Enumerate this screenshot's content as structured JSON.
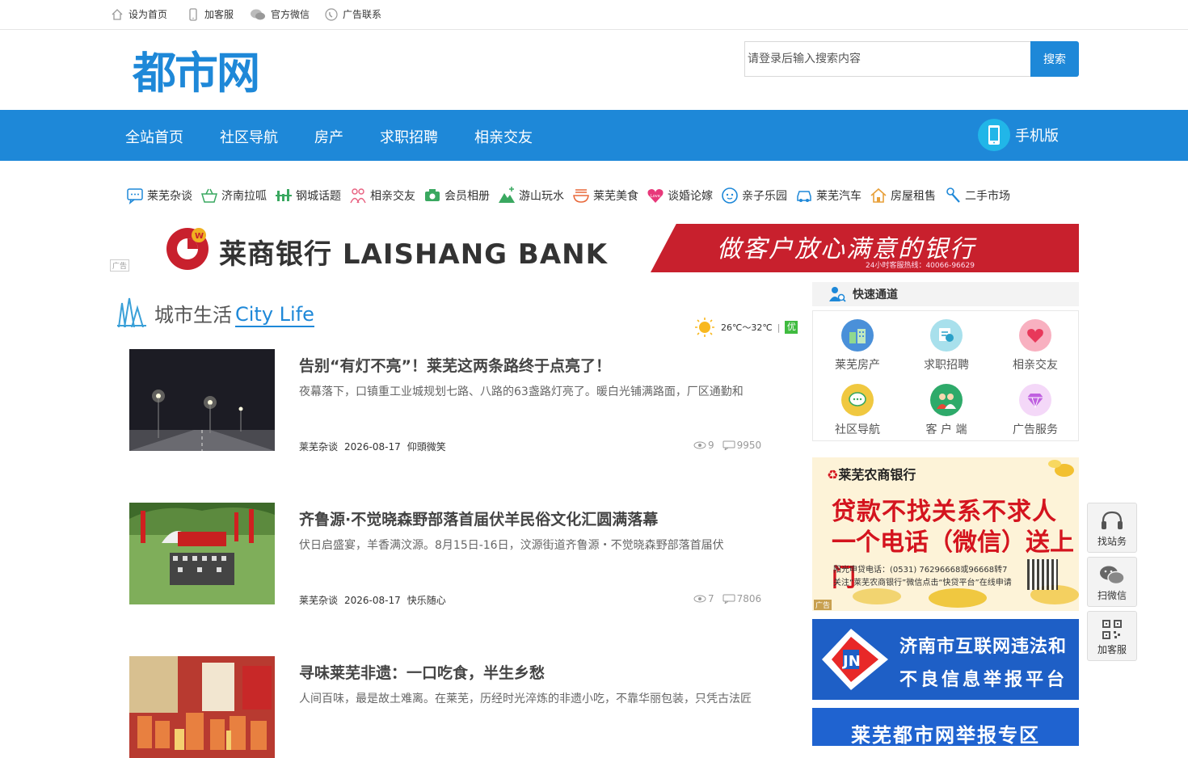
{
  "topbar": {
    "items": [
      {
        "label": "设为首页",
        "icon": "home-icon"
      },
      {
        "label": "加客服",
        "icon": "phone-icon"
      },
      {
        "label": "官方微信",
        "icon": "wechat-icon"
      },
      {
        "label": "广告联系",
        "icon": "contact-icon"
      }
    ]
  },
  "header": {
    "logo_text": "都市网",
    "search": {
      "placeholder": "请登录后输入搜索内容",
      "button": "搜索"
    }
  },
  "nav": {
    "items": [
      "全站首页",
      "社区导航",
      "房产",
      "求职招聘",
      "相亲交友"
    ],
    "mobile": "手机版"
  },
  "categories": [
    {
      "label": "莱芜杂谈",
      "icon": "chat-icon"
    },
    {
      "label": "济南拉呱",
      "icon": "basket-icon"
    },
    {
      "label": "钢城话题",
      "icon": "bars-icon"
    },
    {
      "label": "相亲交友",
      "icon": "couple-icon"
    },
    {
      "label": "会员相册",
      "icon": "camera-icon"
    },
    {
      "label": "游山玩水",
      "icon": "mountain-icon"
    },
    {
      "label": "莱芜美食",
      "icon": "bowl-icon"
    },
    {
      "label": "谈婚论嫁",
      "icon": "heart-love-icon"
    },
    {
      "label": "亲子乐园",
      "icon": "baby-icon"
    },
    {
      "label": "莱芜汽车",
      "icon": "car-icon"
    },
    {
      "label": "房屋租售",
      "icon": "house-icon"
    },
    {
      "label": "二手市场",
      "icon": "wrench-icon"
    }
  ],
  "banner": {
    "ad_tag": "广告",
    "bank_name": "莱商银行 LAISHANG BANK",
    "slogan": "做客户放心满意的银行",
    "hotline": "24小时客服热线：40066-96629"
  },
  "section": {
    "title_zh": "城市生活",
    "title_en": "City Life"
  },
  "weather": {
    "temp": "26℃～32℃",
    "sep": "|",
    "aq": "优"
  },
  "articles": [
    {
      "title": "告别“有灯不亮”！莱芜这两条路终于点亮了！",
      "desc": "夜幕落下，口镇重工业城规划七路、八路的63盏路灯亮了。暖白光铺满路面，厂区通勤和",
      "category": "莱芜杂谈",
      "date": "2026-08-17",
      "author": "仰頭微笑",
      "views": "9",
      "comments": "9950"
    },
    {
      "title": "齐鲁源·不觉晓森野部落首届伏羊民俗文化汇圆满落幕",
      "desc": "伏日启盛宴，羊香满汶源。8月15日-16日，汶源街道齐鲁源・不觉晓森野部落首届伏",
      "category": "莱芜杂谈",
      "date": "2026-08-17",
      "author": "快乐随心",
      "views": "7",
      "comments": "7806"
    },
    {
      "title": "寻味莱芜非遗：一口吃食，半生乡愁",
      "desc": "人间百味，最是故土难离。在莱芜，历经时光淬炼的非遗小吃，不靠华丽包装，只凭古法匠",
      "category": "",
      "date": "",
      "author": "",
      "views": "",
      "comments": ""
    }
  ],
  "quick": {
    "title": "快速通道",
    "items": [
      {
        "label": "莱芜房产",
        "icon": "building-icon",
        "color": "#4a90d9"
      },
      {
        "label": "求职招聘",
        "icon": "job-icon",
        "color": "#5bc0de"
      },
      {
        "label": "相亲交友",
        "icon": "heart-icon",
        "color": "#f06080"
      },
      {
        "label": "社区导航",
        "icon": "speech-icon",
        "color": "#e8b830"
      },
      {
        "label": "客 户 端",
        "icon": "people-icon",
        "color": "#2eaa6a"
      },
      {
        "label": "广告服务",
        "icon": "diamond-icon",
        "color": "#c070e0"
      }
    ]
  },
  "ads": {
    "rural_bank": {
      "name": "莱芜农商银行",
      "line1": "贷款不找关系不求人",
      "line2": "一个电话（微信）送上门",
      "small1": "阳光申贷电话：(0531) 76296668或96668转7",
      "small2": "关注“莱芜农商银行”微信点击“快贷平台”在线申请",
      "tag": "广告"
    },
    "report_platform": {
      "line1": "济南市互联网违法和",
      "line2": "不良信息举报平台"
    },
    "report_zone": {
      "text": "莱芜都市网举报专区"
    }
  },
  "side": [
    {
      "label": "找站务",
      "icon": "headset-icon"
    },
    {
      "label": "扫微信",
      "icon": "wechat-icon"
    },
    {
      "label": "加客服",
      "icon": "qrcode-icon"
    }
  ]
}
